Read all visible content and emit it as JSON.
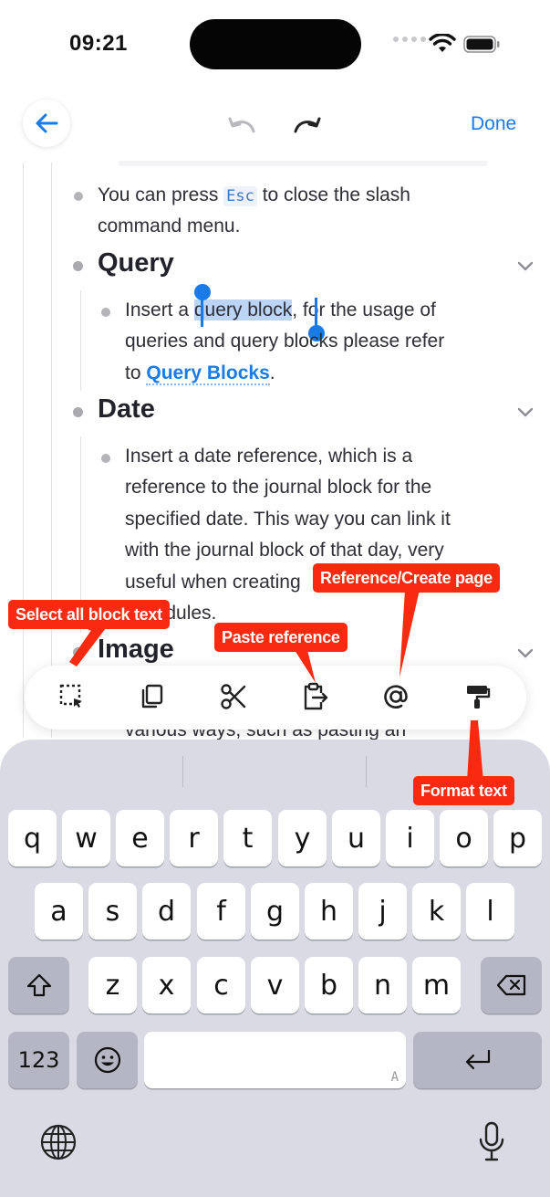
{
  "status_bar": {
    "time": "09:21"
  },
  "nav": {
    "done_label": "Done"
  },
  "content": {
    "esc_line1_pre": "You can press ",
    "esc_code": "Esc",
    "esc_line1_post": " to close the slash",
    "esc_line2": "command menu.",
    "query_heading": "Query",
    "query_line1_pre": "Insert a ",
    "query_line1_sel": "query block",
    "query_line1_post": ", for the usage of",
    "query_line2": "queries and query blocks please refer",
    "query_line3_pre": "to ",
    "query_link": "Query Blocks",
    "query_line3_post": ".",
    "date_heading": "Date",
    "date_lines": [
      "Insert a date reference, which is a",
      "reference to the journal block for the",
      "specified date. This way you can link it",
      "with the journal block of that day, very",
      "useful when creating",
      "schedules."
    ],
    "image_heading": "Image",
    "image_line1": "various ways, such as pasting an"
  },
  "toolbar": {
    "tools": [
      {
        "name": "select-all-icon"
      },
      {
        "name": "copy-icon"
      },
      {
        "name": "cut-icon"
      },
      {
        "name": "paste-reference-icon"
      },
      {
        "name": "at-icon"
      },
      {
        "name": "format-brush-icon"
      }
    ]
  },
  "annotations": {
    "select_all": "Select all block text",
    "paste_reference": "Paste reference",
    "reference_create": "Reference/Create page",
    "format_text": "Format text"
  },
  "keyboard": {
    "row1": [
      "q",
      "w",
      "e",
      "r",
      "t",
      "y",
      "u",
      "i",
      "o",
      "p"
    ],
    "row2": [
      "a",
      "s",
      "d",
      "f",
      "g",
      "h",
      "j",
      "k",
      "l"
    ],
    "row3": [
      "z",
      "x",
      "c",
      "v",
      "b",
      "n",
      "m"
    ],
    "numbers_label": "123",
    "space_hint": "A"
  },
  "colors": {
    "accent": "#1a7be8",
    "annotation": "#fa2a10",
    "keyboard_bg": "#d9dae4"
  }
}
